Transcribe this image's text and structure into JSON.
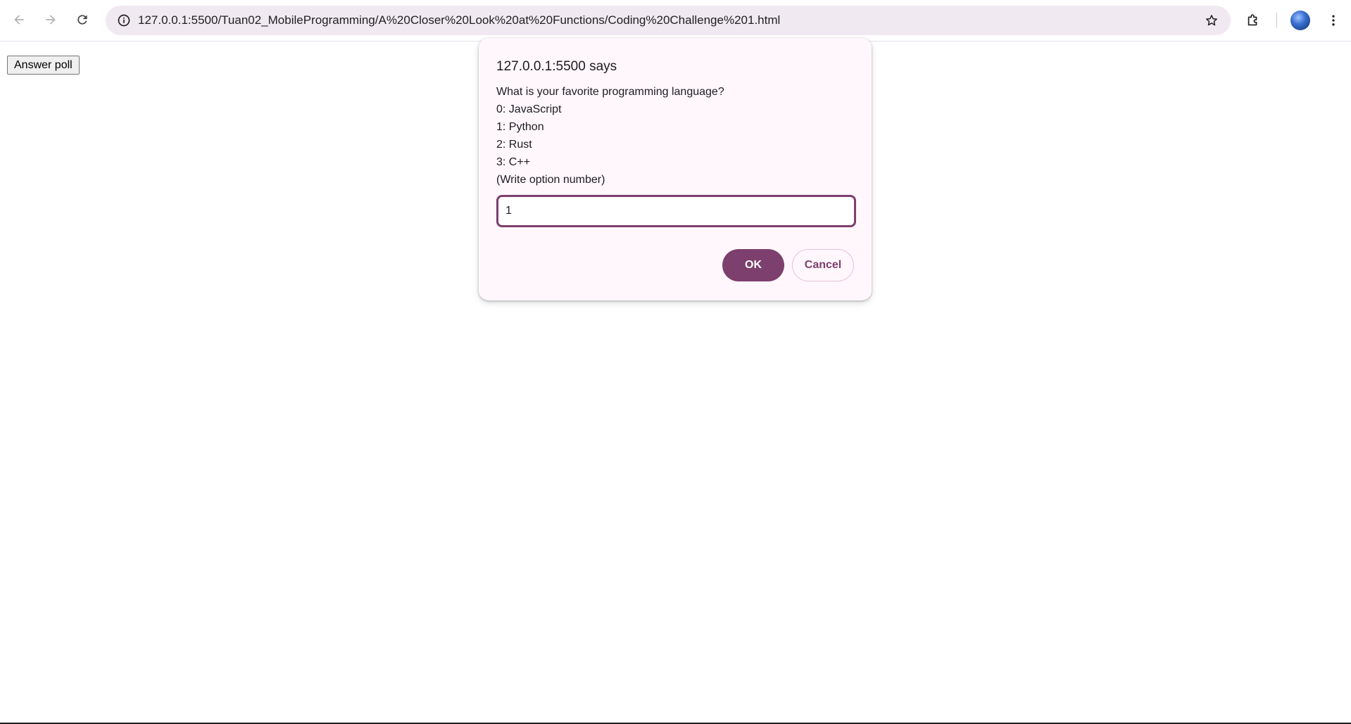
{
  "browser": {
    "url": "127.0.0.1:5500/Tuan02_MobileProgramming/A%20Closer%20Look%20at%20Functions/Coding%20Challenge%201.html",
    "icons": [
      "back-arrow-icon",
      "forward-arrow-icon",
      "reload-icon",
      "site-info-icon",
      "bookmark-star-icon",
      "extensions-puzzle-icon",
      "avatar",
      "more-vert-icon"
    ]
  },
  "page": {
    "answer_button_label": "Answer poll"
  },
  "dialog": {
    "title": "127.0.0.1:5500 says",
    "message_lines": [
      "What is your favorite programming language?",
      "0: JavaScript",
      "1: Python",
      "2: Rust",
      "3: C++",
      "(Write option number)"
    ],
    "input_value": "1",
    "ok_label": "OK",
    "cancel_label": "Cancel"
  },
  "colors": {
    "accent": "#7d3f6d",
    "dialog_bg": "#fff7fb",
    "omnibox_bg": "#f1e9f1"
  }
}
